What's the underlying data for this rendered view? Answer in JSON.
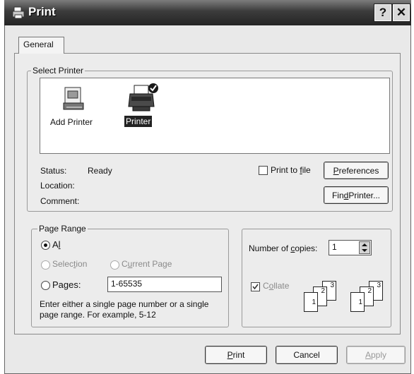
{
  "window": {
    "title": "Print",
    "help_button": "?",
    "close_button": "✕"
  },
  "tabs": [
    {
      "label": "General"
    }
  ],
  "select_printer": {
    "label": "Select Printer",
    "printers": [
      {
        "name": "Add Printer",
        "icon": "add-printer-icon"
      },
      {
        "name": "Printer",
        "icon": "printer-icon",
        "selected": true
      }
    ],
    "status_label": "Status:",
    "status_value": "Ready",
    "location_label": "Location:",
    "comment_label": "Comment:",
    "print_to_file": {
      "label_pre": "Print to ",
      "label_u": "f",
      "label_post": "ile",
      "checked": false
    },
    "preferences_button": {
      "u": "P",
      "rest": "references"
    },
    "find_printer_button": {
      "pre": "Fin",
      "u": "d",
      "post": " Printer..."
    }
  },
  "page_range": {
    "label": "Page Range",
    "all": {
      "u": "l",
      "pre": "A",
      "post": "",
      "selected": true
    },
    "selection": {
      "pre": "Selec",
      "u": "t",
      "post": "ion"
    },
    "current_page": {
      "pre": "C",
      "u": "u",
      "post": "rrent Page"
    },
    "pages": {
      "label": "Pages:",
      "value": "1-65535"
    },
    "hint_line1": "Enter either a single page number or a single",
    "hint_line2": "page range.  For example, 5-12"
  },
  "copies": {
    "number_pre": "Number of ",
    "number_u": "c",
    "number_post": "opies:",
    "value": "1",
    "collate": {
      "pre": "C",
      "u": "o",
      "post": "llate",
      "checked": true
    },
    "collate_pages": [
      "1",
      "2",
      "3"
    ]
  },
  "footer": {
    "print_button": {
      "u": "P",
      "rest": "rint"
    },
    "cancel_button": "Cancel",
    "apply_button": {
      "u": "A",
      "rest": "pply"
    }
  }
}
